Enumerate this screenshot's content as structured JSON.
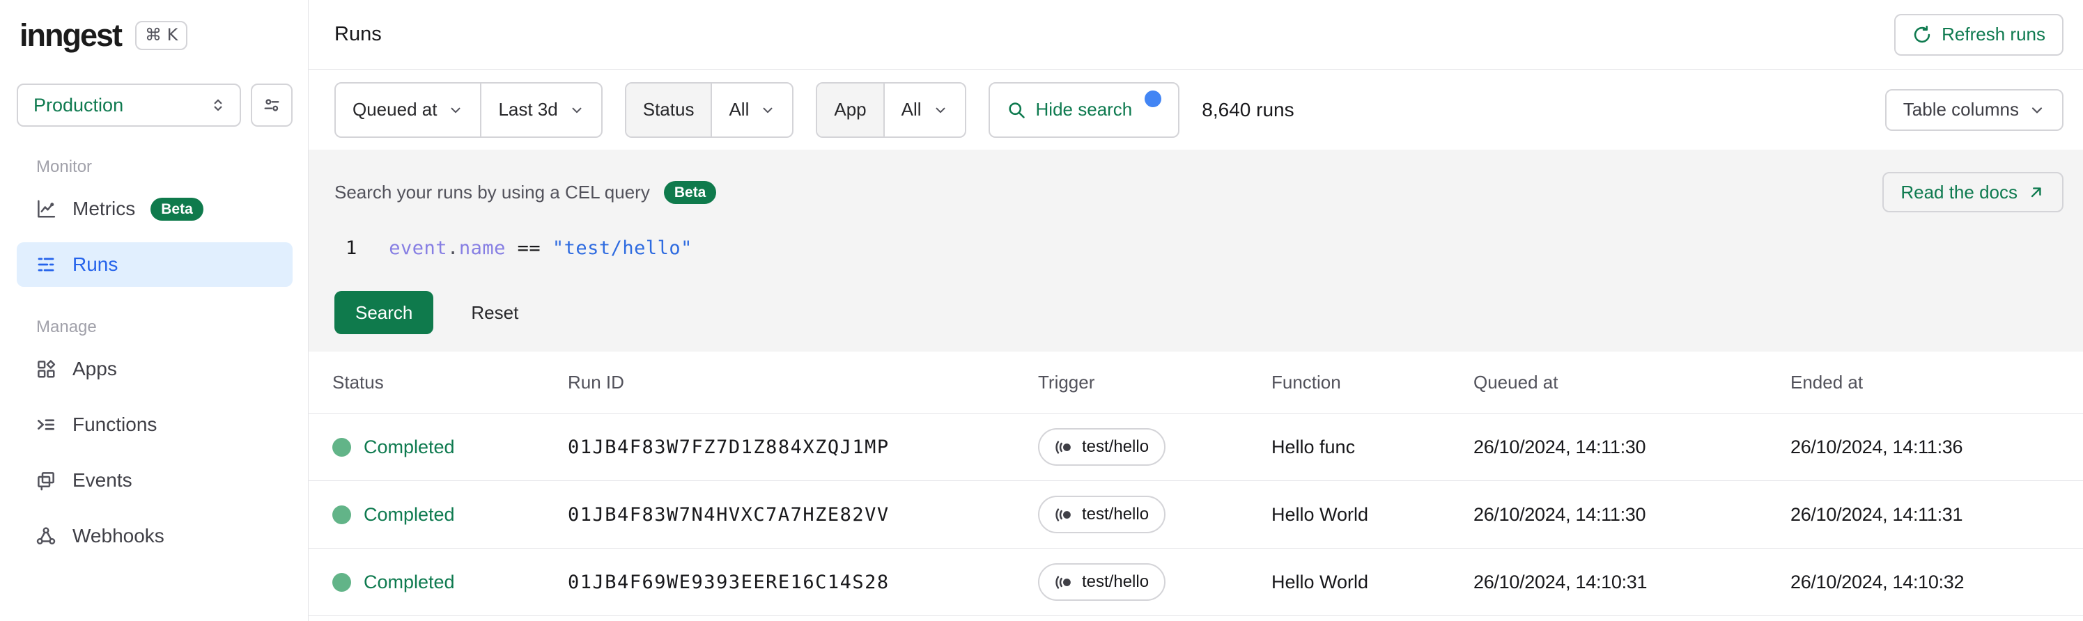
{
  "brand": {
    "logo": "inngest",
    "shortcut": "⌘ K"
  },
  "sidebar": {
    "environment": "Production",
    "sections": [
      {
        "label": "Monitor",
        "items": [
          {
            "label": "Metrics",
            "icon": "metrics-icon",
            "badge": "Beta",
            "active": false
          },
          {
            "label": "Runs",
            "icon": "runs-icon",
            "active": true
          }
        ]
      },
      {
        "label": "Manage",
        "items": [
          {
            "label": "Apps",
            "icon": "apps-icon",
            "active": false
          },
          {
            "label": "Functions",
            "icon": "functions-icon",
            "active": false
          },
          {
            "label": "Events",
            "icon": "events-icon",
            "active": false
          },
          {
            "label": "Webhooks",
            "icon": "webhooks-icon",
            "active": false
          }
        ]
      }
    ]
  },
  "header": {
    "title": "Runs",
    "refresh_label": "Refresh runs"
  },
  "filters": {
    "time_field": "Queued at",
    "time_range": "Last 3d",
    "status_label": "Status",
    "status_value": "All",
    "app_label": "App",
    "app_value": "All",
    "search_toggle_label": "Hide search",
    "runs_count": "8,640 runs",
    "table_columns_label": "Table columns"
  },
  "search": {
    "title": "Search your runs by using a CEL query",
    "badge": "Beta",
    "docs_label": "Read the docs",
    "line_number": "1",
    "code": {
      "object": "event",
      "dot": ".",
      "property": "name",
      "operator": " == ",
      "value": "\"test/hello\""
    },
    "search_label": "Search",
    "reset_label": "Reset"
  },
  "table": {
    "columns": [
      "Status",
      "Run ID",
      "Trigger",
      "Function",
      "Queued at",
      "Ended at"
    ],
    "rows": [
      {
        "status": "Completed",
        "run_id": "01JB4F83W7FZ7D1Z884XZQJ1MP",
        "trigger": "test/hello",
        "function": "Hello func",
        "queued_at": "26/10/2024, 14:11:30",
        "ended_at": "26/10/2024, 14:11:36"
      },
      {
        "status": "Completed",
        "run_id": "01JB4F83W7N4HVXC7A7HZE82VV",
        "trigger": "test/hello",
        "function": "Hello World",
        "queued_at": "26/10/2024, 14:11:30",
        "ended_at": "26/10/2024, 14:11:31"
      },
      {
        "status": "Completed",
        "run_id": "01JB4F69WE9393EERE16C14S28",
        "trigger": "test/hello",
        "function": "Hello World",
        "queued_at": "26/10/2024, 14:10:31",
        "ended_at": "26/10/2024, 14:10:32"
      }
    ]
  },
  "colors": {
    "accent_green": "#0e7a4f",
    "active_blue": "#2563eb",
    "notification_blue": "#4285f4",
    "status_dot_green": "#62b488",
    "code_purple": "#867ee3",
    "code_string_blue": "#2e6be0",
    "panel_gray": "#f4f4f4"
  }
}
